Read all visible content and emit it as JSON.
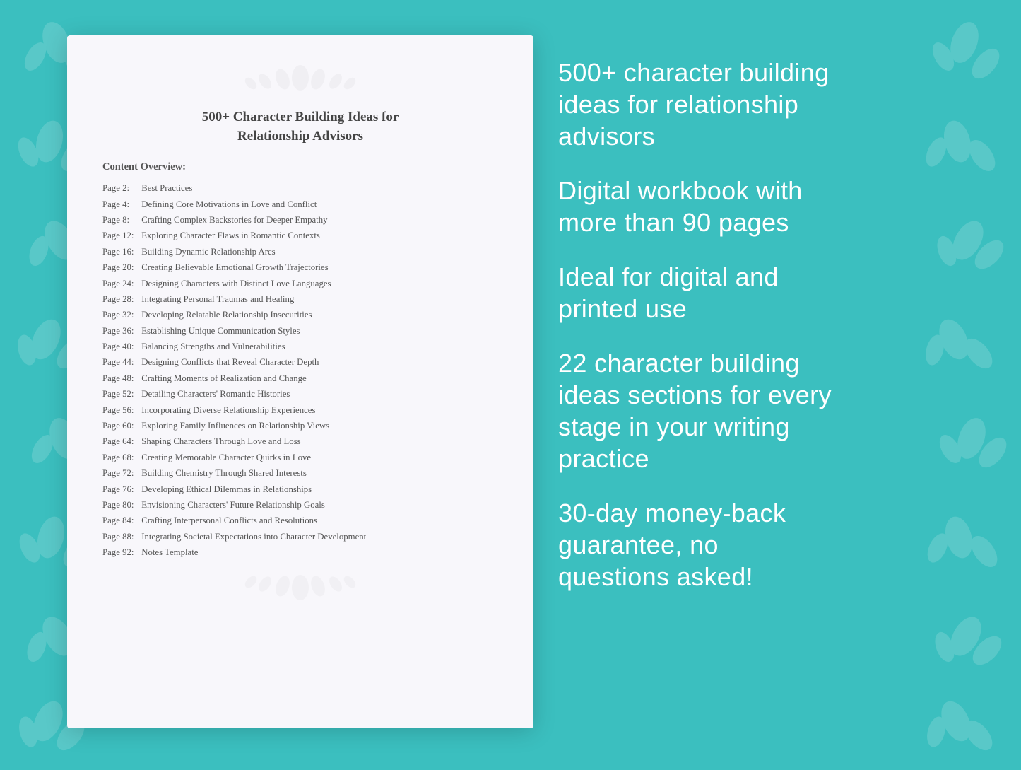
{
  "document": {
    "title_line1": "500+ Character Building Ideas for",
    "title_line2": "Relationship Advisors",
    "content_label": "Content Overview:",
    "toc": [
      {
        "page": "Page  2:",
        "title": "Best Practices"
      },
      {
        "page": "Page  4:",
        "title": "Defining Core Motivations in Love and Conflict"
      },
      {
        "page": "Page  8:",
        "title": "Crafting Complex Backstories for Deeper Empathy"
      },
      {
        "page": "Page 12:",
        "title": "Exploring Character Flaws in Romantic Contexts"
      },
      {
        "page": "Page 16:",
        "title": "Building Dynamic Relationship Arcs"
      },
      {
        "page": "Page 20:",
        "title": "Creating Believable Emotional Growth Trajectories"
      },
      {
        "page": "Page 24:",
        "title": "Designing Characters with Distinct Love Languages"
      },
      {
        "page": "Page 28:",
        "title": "Integrating Personal Traumas and Healing"
      },
      {
        "page": "Page 32:",
        "title": "Developing Relatable Relationship Insecurities"
      },
      {
        "page": "Page 36:",
        "title": "Establishing Unique Communication Styles"
      },
      {
        "page": "Page 40:",
        "title": "Balancing Strengths and Vulnerabilities"
      },
      {
        "page": "Page 44:",
        "title": "Designing Conflicts that Reveal Character Depth"
      },
      {
        "page": "Page 48:",
        "title": "Crafting Moments of Realization and Change"
      },
      {
        "page": "Page 52:",
        "title": "Detailing Characters' Romantic Histories"
      },
      {
        "page": "Page 56:",
        "title": "Incorporating Diverse Relationship Experiences"
      },
      {
        "page": "Page 60:",
        "title": "Exploring Family Influences on Relationship Views"
      },
      {
        "page": "Page 64:",
        "title": "Shaping Characters Through Love and Loss"
      },
      {
        "page": "Page 68:",
        "title": "Creating Memorable Character Quirks in Love"
      },
      {
        "page": "Page 72:",
        "title": "Building Chemistry Through Shared Interests"
      },
      {
        "page": "Page 76:",
        "title": "Developing Ethical Dilemmas in Relationships"
      },
      {
        "page": "Page 80:",
        "title": "Envisioning Characters' Future Relationship Goals"
      },
      {
        "page": "Page 84:",
        "title": "Crafting Interpersonal Conflicts and Resolutions"
      },
      {
        "page": "Page 88:",
        "title": "Integrating Societal Expectations into Character Development"
      },
      {
        "page": "Page 92:",
        "title": "Notes Template"
      }
    ]
  },
  "features": [
    {
      "text": "500+ character building\nideas for relationship\nadvisors"
    },
    {
      "text": "Digital workbook with\nmore than 90 pages"
    },
    {
      "text": "Ideal for digital and\nprinted use"
    },
    {
      "text": "22 character building\nideas sections for every\nstage in your writing\npractice"
    },
    {
      "text": "30-day money-back\nguarantee, no\nquestions asked!"
    }
  ]
}
